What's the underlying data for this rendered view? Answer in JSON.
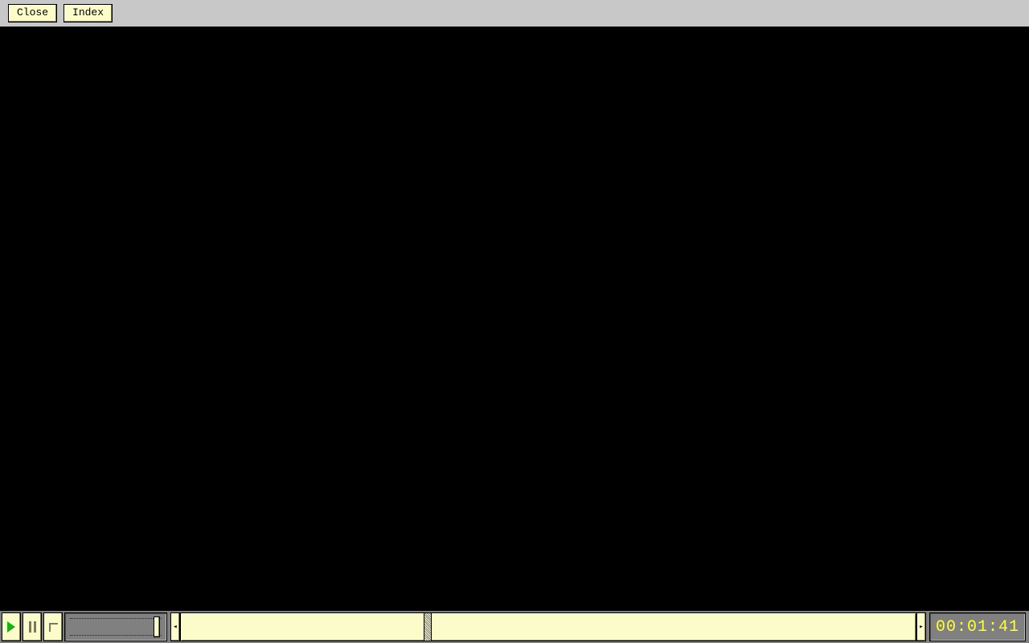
{
  "toolbar": {
    "close_label": "Close",
    "index_label": "Index"
  },
  "player": {
    "timecode": "00:01:41",
    "seek_left_glyph": "◂",
    "seek_right_glyph": "▸"
  }
}
